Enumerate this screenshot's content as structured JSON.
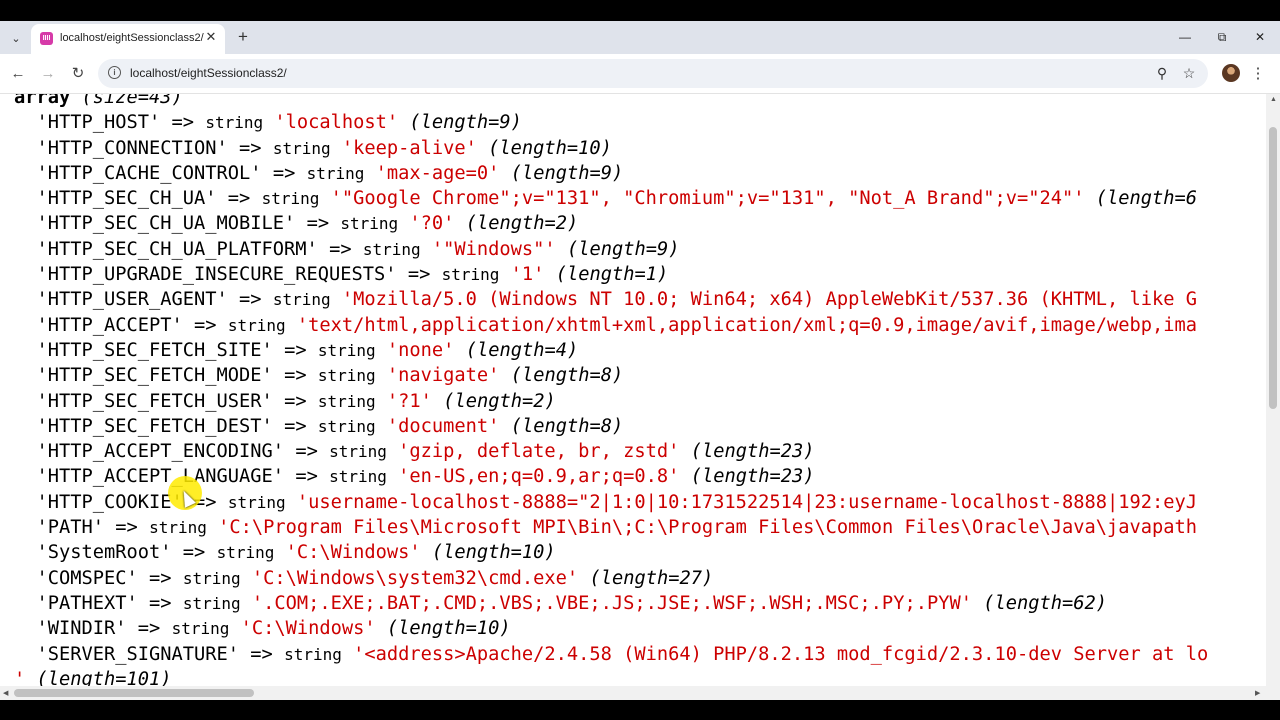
{
  "browser": {
    "tab_title": "localhost/eightSessionclass2/",
    "favicon_text": "IIII",
    "url": "localhost/eightSessionclass2/",
    "icons": {
      "tab_dropdown": "chevron-down-icon",
      "close_tab": "close-icon",
      "new_tab": "plus-icon",
      "minimize": "minimize-icon",
      "restore": "restore-icon",
      "close_window": "close-icon",
      "back": "arrow-left-icon",
      "forward": "arrow-right-icon",
      "reload": "reload-icon",
      "site_info": "info-icon",
      "zoom": "zoom-icon",
      "bookmark": "star-icon",
      "profile": "avatar",
      "menu": "kebab-menu-icon"
    }
  },
  "dump": {
    "header": {
      "keyword": "array",
      "size": "(size=43)"
    },
    "arrow": "=>",
    "type": "string",
    "rows": [
      {
        "key": "'HTTP_HOST'",
        "value": "'localhost'",
        "length": "(length=9)"
      },
      {
        "key": "'HTTP_CONNECTION'",
        "value": "'keep-alive'",
        "length": "(length=10)"
      },
      {
        "key": "'HTTP_CACHE_CONTROL'",
        "value": "'max-age=0'",
        "length": "(length=9)"
      },
      {
        "key": "'HTTP_SEC_CH_UA'",
        "value": "'\"Google Chrome\";v=\"131\", \"Chromium\";v=\"131\", \"Not_A Brand\";v=\"24\"'",
        "length": "(length=6"
      },
      {
        "key": "'HTTP_SEC_CH_UA_MOBILE'",
        "value": "'?0'",
        "length": "(length=2)"
      },
      {
        "key": "'HTTP_SEC_CH_UA_PLATFORM'",
        "value": "'\"Windows\"'",
        "length": "(length=9)"
      },
      {
        "key": "'HTTP_UPGRADE_INSECURE_REQUESTS'",
        "value": "'1'",
        "length": "(length=1)"
      },
      {
        "key": "'HTTP_USER_AGENT'",
        "value": "'Mozilla/5.0 (Windows NT 10.0; Win64; x64) AppleWebKit/537.36 (KHTML, like G",
        "length": ""
      },
      {
        "key": "'HTTP_ACCEPT'",
        "value": "'text/html,application/xhtml+xml,application/xml;q=0.9,image/avif,image/webp,ima",
        "length": ""
      },
      {
        "key": "'HTTP_SEC_FETCH_SITE'",
        "value": "'none'",
        "length": "(length=4)"
      },
      {
        "key": "'HTTP_SEC_FETCH_MODE'",
        "value": "'navigate'",
        "length": "(length=8)"
      },
      {
        "key": "'HTTP_SEC_FETCH_USER'",
        "value": "'?1'",
        "length": "(length=2)"
      },
      {
        "key": "'HTTP_SEC_FETCH_DEST'",
        "value": "'document'",
        "length": "(length=8)"
      },
      {
        "key": "'HTTP_ACCEPT_ENCODING'",
        "value": "'gzip, deflate, br, zstd'",
        "length": "(length=23)"
      },
      {
        "key": "'HTTP_ACCEPT_LANGUAGE'",
        "value": "'en-US,en;q=0.9,ar;q=0.8'",
        "length": "(length=23)"
      },
      {
        "key": "'HTTP_COOKIE'",
        "value": "'username-localhost-8888=\"2|1:0|10:1731522514|23:username-localhost-8888|192:eyJ",
        "length": ""
      },
      {
        "key": "'PATH'",
        "value": "'C:\\Program Files\\Microsoft MPI\\Bin\\;C:\\Program Files\\Common Files\\Oracle\\Java\\javapath",
        "length": ""
      },
      {
        "key": "'SystemRoot'",
        "value": "'C:\\Windows'",
        "length": "(length=10)"
      },
      {
        "key": "'COMSPEC'",
        "value": "'C:\\Windows\\system32\\cmd.exe'",
        "length": "(length=27)"
      },
      {
        "key": "'PATHEXT'",
        "value": "'.COM;.EXE;.BAT;.CMD;.VBS;.VBE;.JS;.JSE;.WSF;.WSH;.MSC;.PY;.PYW'",
        "length": "(length=62)"
      },
      {
        "key": "'WINDIR'",
        "value": "'C:\\Windows'",
        "length": "(length=10)"
      },
      {
        "key": "'SERVER_SIGNATURE'",
        "value": "'<address>Apache/2.4.58 (Win64) PHP/8.2.13 mod_fcgid/2.3.10-dev Server at lo",
        "length": ""
      }
    ],
    "trailer": {
      "value": "'",
      "length": "(length=101)"
    }
  }
}
